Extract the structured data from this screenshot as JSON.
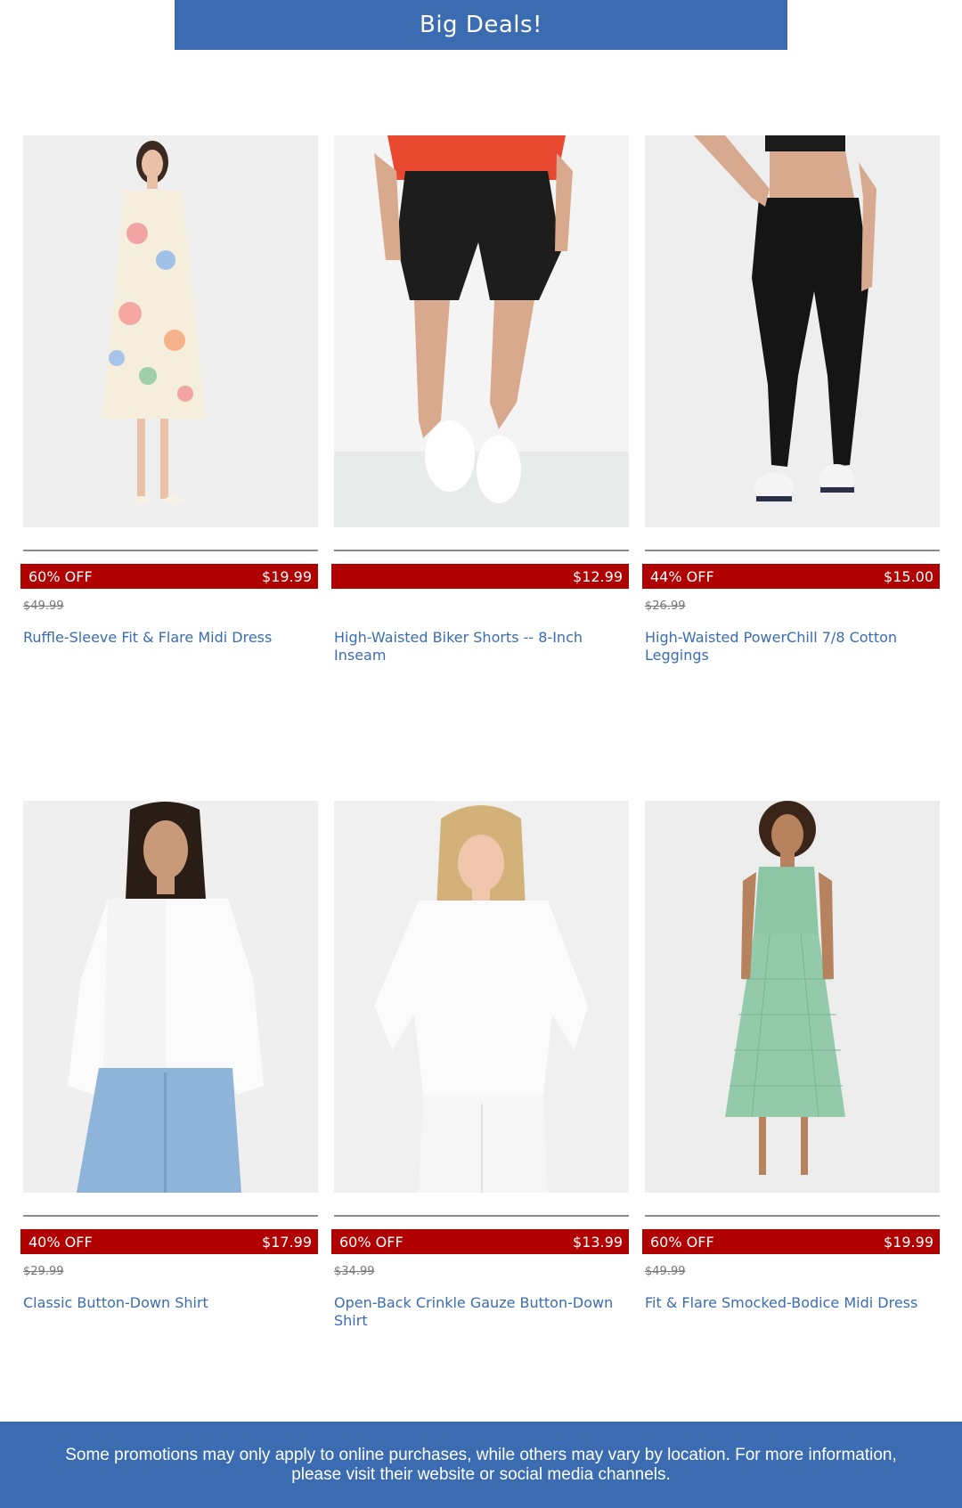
{
  "banner": {
    "title": "Big Deals!"
  },
  "products": [
    {
      "image_alt": "woman in floral midi dress",
      "discount": "60% OFF",
      "price": "$19.99",
      "original_price": "$49.99",
      "name": "Ruffle-Sleeve Fit & Flare Midi Dress"
    },
    {
      "image_alt": "woman in black biker shorts",
      "discount": "",
      "price": "$12.99",
      "original_price": "",
      "name": "High-Waisted Biker Shorts -- 8-Inch Inseam"
    },
    {
      "image_alt": "woman in black leggings",
      "discount": "44% OFF",
      "price": "$15.00",
      "original_price": "$26.99",
      "name": "High-Waisted PowerChill 7/8 Cotton Leggings"
    },
    {
      "image_alt": "woman in white button-down shirt and jeans",
      "discount": "40% OFF",
      "price": "$17.99",
      "original_price": "$29.99",
      "name": "Classic Button-Down Shirt"
    },
    {
      "image_alt": "woman in white gauze shirt",
      "discount": "60% OFF",
      "price": "$13.99",
      "original_price": "$34.99",
      "name": "Open-Back Crinkle Gauze Button-Down Shirt"
    },
    {
      "image_alt": "woman in green gingham midi dress",
      "discount": "60% OFF",
      "price": "$19.99",
      "original_price": "$49.99",
      "name": "Fit & Flare Smocked-Bodice Midi Dress"
    }
  ],
  "footer": {
    "text": "Some promotions may only apply to online purchases, while others may vary by location. For more information, please visit their website or social media channels."
  },
  "colors": {
    "brand_blue": "#3b6cb2",
    "sale_red": "#b00000"
  }
}
